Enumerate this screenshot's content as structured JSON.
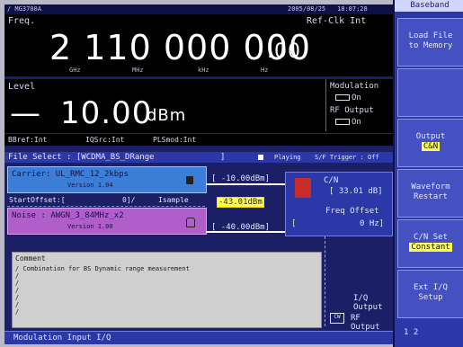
{
  "top": {
    "logo": "/ MG3700A",
    "date": "2005/08/25",
    "time": "18:07:28"
  },
  "freq": {
    "label": "Freq.",
    "ref": "Ref-Clk Int",
    "main": "2 110 000 000",
    "frac": ".00",
    "units": [
      "GHz",
      "MHz",
      "kHz",
      "Hz"
    ]
  },
  "level": {
    "label": "Level",
    "sign": "—",
    "value": "10.00",
    "unit": "dBm"
  },
  "modulation": {
    "label": "Modulation",
    "value": "On"
  },
  "rf_output": {
    "label": "RF Output",
    "value": "On"
  },
  "status_line": {
    "bbref": "BBref:Int",
    "iqsrc": "IQSrc:Int",
    "plsmod": "PLSmod:Int"
  },
  "file_select": {
    "label": "File Select : [WCDMA_BS_DRange",
    "bracket": "]",
    "playing": "Playing",
    "trigger": "S/F Trigger : Off"
  },
  "carrier": {
    "label": "Carrier: UL_RMC_12_2kbps",
    "version": "Version 1.04",
    "level": "[ -10.00dBm]"
  },
  "start_offset": {
    "label": "StartOffset:[",
    "value": "0]/",
    "unit": "Isample"
  },
  "noise": {
    "label": "Noise  : AWGN_3_84MHz_x2",
    "version": "Version 1.00",
    "level": "[ -40.00dBm]",
    "total": "-43.01dBm"
  },
  "cn": {
    "label": "C/N",
    "value": "[ 33.01 dB]"
  },
  "freq_offset": {
    "label": "Freq Offset",
    "value": "0 Hz]",
    "bracket": "["
  },
  "comment": {
    "title": "Comment",
    "lines": [
      "/ Combination for BS Dynamic range measurement",
      "/",
      "/",
      "/",
      "/",
      "/",
      "/"
    ]
  },
  "outputs": {
    "iq": "I/Q Output",
    "rf": "RF Output",
    "cw": "CW"
  },
  "bottom_bar": "Modulation Input I/Q",
  "sidebar": {
    "title": "Baseband",
    "buttons": [
      {
        "line1": "Load File",
        "line2": "to Memory"
      },
      {
        "line1": "",
        "line2": ""
      },
      {
        "line1": "Output",
        "line2": "C&N"
      },
      {
        "line1": "Waveform",
        "line2": "Restart"
      },
      {
        "line1": "C/N Set",
        "line2": "Constant"
      },
      {
        "line1": "Ext I/Q",
        "line2": "Setup"
      }
    ],
    "page": "1  2"
  }
}
